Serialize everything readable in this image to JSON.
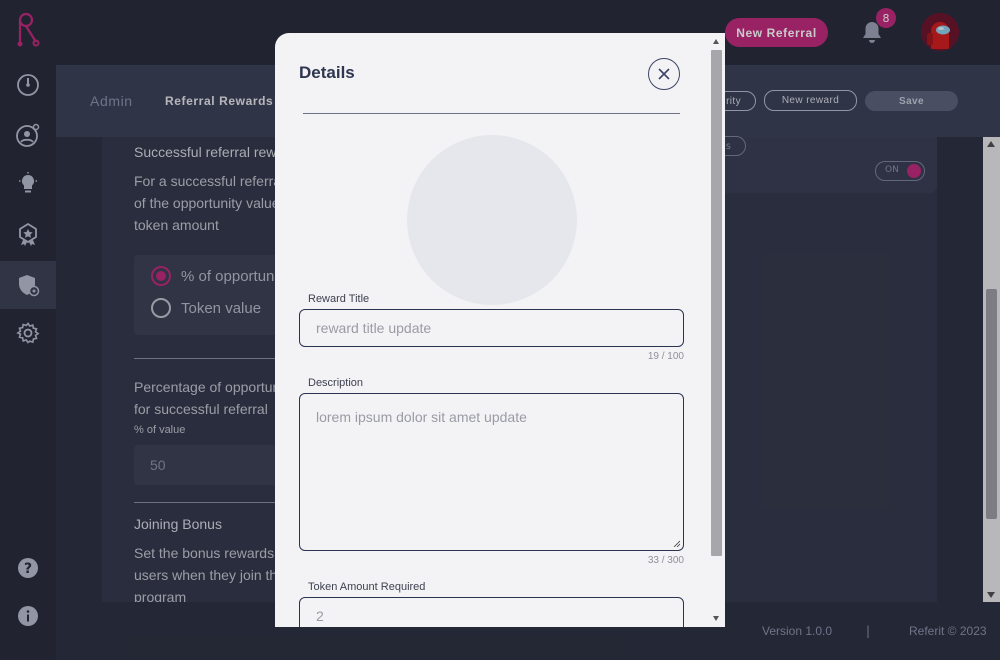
{
  "colors": {
    "accent": "#c0287a",
    "modal_bg": "#f3f3f5",
    "dark_bg": "#2b2f3e"
  },
  "header": {
    "new_referral_label": "New Referral",
    "notification_count": "8",
    "bell_icon": "bell-icon",
    "avatar_icon": "avatar"
  },
  "sidebar": {
    "items": [
      {
        "icon": "dashboard-gauge-icon"
      },
      {
        "icon": "referrals-user-icon"
      },
      {
        "icon": "ideas-lightbulb-icon"
      },
      {
        "icon": "rewards-badge-icon"
      },
      {
        "icon": "admin-shield-icon",
        "active": true
      },
      {
        "icon": "settings-gear-icon"
      }
    ],
    "bottom": [
      {
        "icon": "help-icon"
      },
      {
        "icon": "info-icon"
      }
    ]
  },
  "subheader": {
    "breadcrumb_admin": "Admin",
    "breadcrumb_page": "Referral Rewards",
    "pill_partial": "rity",
    "new_reward_label": "New reward",
    "save_label": "Save",
    "small_pill_partial": "ls",
    "toggle_label": "ON"
  },
  "background": {
    "section_title": "Successful referral rewa",
    "section_text_1": "For a successful referral",
    "section_text_2": "of the opportunity value",
    "section_text_3": "token amount",
    "radio_1": "% of opportun",
    "radio_2": "Token value",
    "pct_text_1": "Percentage of opportun",
    "pct_text_2": "for successful referral",
    "pct_label": "% of value",
    "pct_value": "50",
    "joining_title": "Joining Bonus",
    "joining_text_1": "Set the bonus rewards fo",
    "joining_text_2": "users when they join the",
    "joining_text_3": "program"
  },
  "footer": {
    "version": "Version 1.0.0",
    "separator": "|",
    "copyright": "Referit © 2023"
  },
  "modal": {
    "title": "Details",
    "reward_title_label": "Reward Title",
    "reward_title_value": "reward title update",
    "reward_title_counter": "19 / 100",
    "description_label": "Description",
    "description_value": "lorem ipsum dolor sit amet update",
    "description_counter": "33 / 300",
    "token_label": "Token Amount Required",
    "token_value": "2"
  }
}
